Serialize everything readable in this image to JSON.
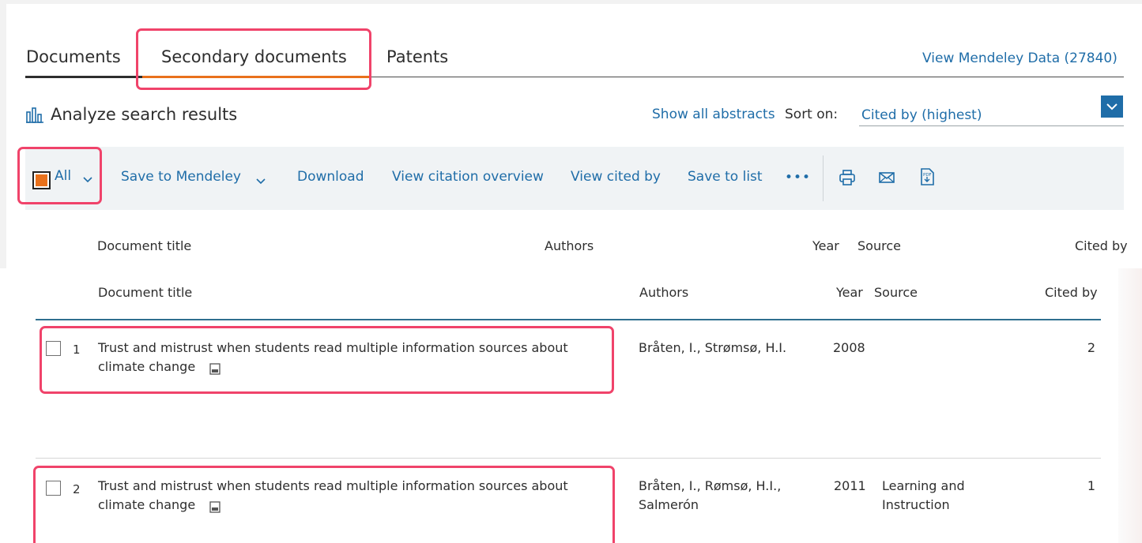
{
  "tabs": {
    "documents": "Documents",
    "secondary": "Secondary documents",
    "patents": "Patents"
  },
  "mendeley_data_link": "View Mendeley Data (27840)",
  "analyze_label": "Analyze search results",
  "show_abstracts": "Show all abstracts",
  "sort_label": "Sort on:",
  "sort_value": "Cited by (highest)",
  "select_all_label": "All",
  "toolbar": {
    "save_mendeley": "Save to Mendeley",
    "download": "Download",
    "citation_overview": "View citation overview",
    "cited_by": "View cited by",
    "save_list": "Save to list",
    "more": "•••"
  },
  "columns": {
    "title": "Document title",
    "authors": "Authors",
    "year": "Year",
    "source": "Source",
    "cited": "Cited by"
  },
  "rows": [
    {
      "num": "1",
      "title_line1": "Trust and mistrust when students read multiple information sources about",
      "title_line2": "climate change",
      "authors_line1": "Bråten, I., Strømsø, H.I.",
      "authors_line2": "",
      "year": "2008",
      "source_line1": "",
      "source_line2": "",
      "cited": "2"
    },
    {
      "num": "2",
      "title_line1": "Trust and mistrust when students read multiple information sources about",
      "title_line2": "climate change",
      "authors_line1": "Bråten, I., Rømsø, H.I.,",
      "authors_line2": "Salmerón",
      "year": "2011",
      "source_line1": "Learning and",
      "source_line2": "Instruction",
      "cited": "1"
    }
  ],
  "colors": {
    "accent_orange": "#e9711c",
    "link_blue": "#1f6da8",
    "highlight_pink": "#f0436a",
    "table_rule": "#2f6f8f"
  }
}
